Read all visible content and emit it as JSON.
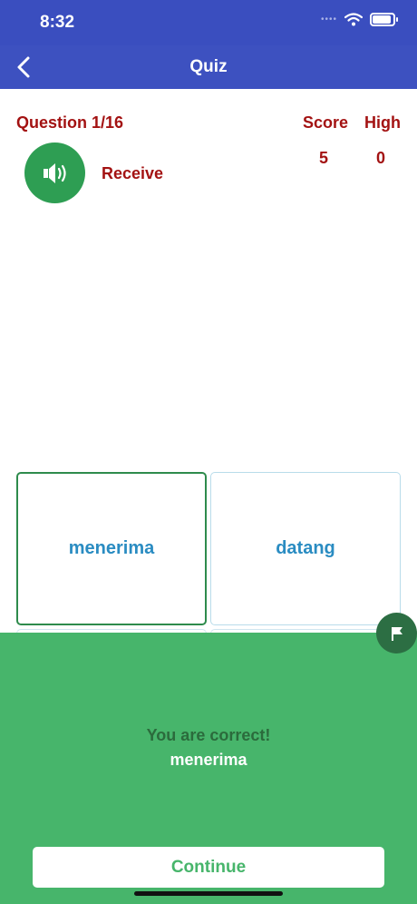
{
  "status": {
    "time": "8:32",
    "signal": "••••"
  },
  "nav": {
    "title": "Quiz"
  },
  "quiz": {
    "question": "Question 1/16",
    "score_label": "Score",
    "high_label": "High",
    "score": "5",
    "high": "0",
    "prompt": "Receive"
  },
  "answers": [
    "menerima",
    "datang",
    "",
    ""
  ],
  "feedback": {
    "title": "You are correct!",
    "word": "menerima",
    "continue_label": "Continue"
  },
  "icons": {
    "back": "chevron-left-icon",
    "speaker": "speaker-icon",
    "flag": "flag-icon"
  },
  "colors": {
    "header": "#3d51c0",
    "accent_red": "#a31212",
    "panel_green": "#47b56b",
    "answer_blue": "#2a8cc2"
  }
}
